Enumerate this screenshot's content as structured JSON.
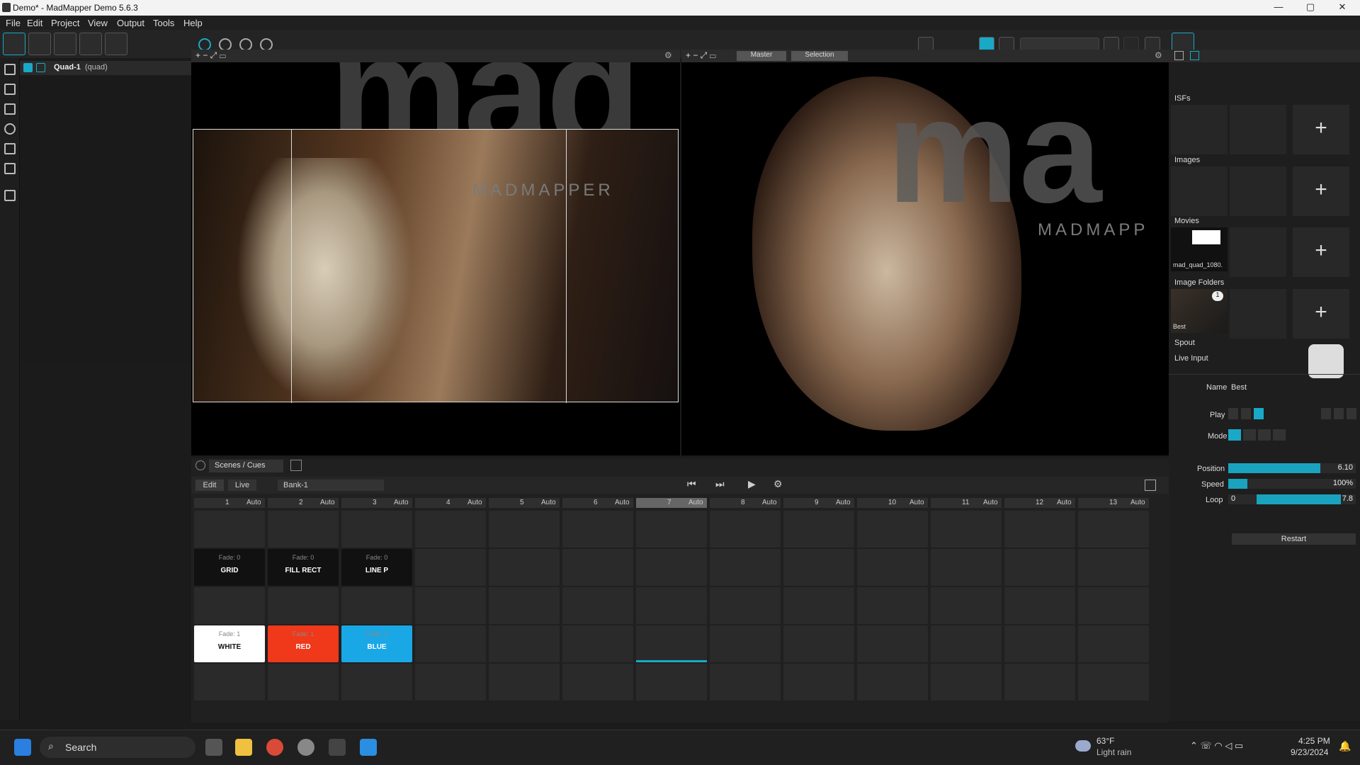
{
  "window": {
    "title": "Demo* - MadMapper Demo 5.6.3",
    "minimize": "—",
    "maximize": "▢",
    "close": "✕"
  },
  "menu": [
    "File",
    "Edit",
    "Project",
    "View",
    "Output",
    "Tools",
    "Help"
  ],
  "toolbar": {
    "icons": [
      "surfaces-icon",
      "lamp-icon",
      "output-icon",
      "cubes-icon",
      "gear-icon"
    ]
  },
  "layer": {
    "name": "Quad-1",
    "type": "(quad)"
  },
  "views": {
    "input_watermark": "MADMAPPER",
    "output_watermark": "MADMAPP",
    "output_tabs": [
      "Master",
      "Selection"
    ],
    "big_letters_left": "mad",
    "big_letters_right": "ma"
  },
  "library": {
    "sections": [
      "ISFs",
      "Images",
      "Movies",
      "Image Folders",
      "Spout",
      "Live Input"
    ],
    "movie_name": "mad_quad_1080.",
    "folder_name": "Best",
    "folder_badge": "1"
  },
  "properties": {
    "name_label": "Name",
    "name_value": "Best",
    "play_label": "Play",
    "mode_label": "Mode",
    "position_label": "Position",
    "position_value": "6.10",
    "position_fraction": 0.72,
    "speed_label": "Speed",
    "speed_value": "100%",
    "speed_fraction": 0.15,
    "loop_label": "Loop",
    "loop_start": "0",
    "loop_end": "7.8",
    "loop_fraction": 0.85,
    "restart": "Restart"
  },
  "scenes": {
    "panel_title": "Scenes / Cues",
    "edit": "Edit",
    "live": "Live",
    "bank": "Bank-1",
    "columns": [
      {
        "num": "1",
        "mode": "Auto"
      },
      {
        "num": "2",
        "mode": "Auto"
      },
      {
        "num": "3",
        "mode": "Auto"
      },
      {
        "num": "4",
        "mode": "Auto"
      },
      {
        "num": "5",
        "mode": "Auto"
      },
      {
        "num": "6",
        "mode": "Auto"
      },
      {
        "num": "7",
        "mode": "Auto"
      },
      {
        "num": "8",
        "mode": "Auto"
      },
      {
        "num": "9",
        "mode": "Auto"
      },
      {
        "num": "10",
        "mode": "Auto"
      },
      {
        "num": "11",
        "mode": "Auto"
      },
      {
        "num": "12",
        "mode": "Auto"
      },
      {
        "num": "13",
        "mode": "Auto"
      }
    ],
    "cues_row2": [
      {
        "fade": "Fade: 0",
        "label": "GRID"
      },
      {
        "fade": "Fade: 0",
        "label": "FILL RECT"
      },
      {
        "fade": "Fade: 0",
        "label": "LINE P"
      }
    ],
    "cues_row4": [
      {
        "fade": "Fade: 1",
        "label": "WHITE",
        "color": "#ffffff"
      },
      {
        "fade": "Fade: 1",
        "label": "RED",
        "color": "#f0381a"
      },
      {
        "fade": "Fade: 1",
        "label": "BLUE",
        "color": "#1aa7e6"
      }
    ]
  },
  "taskbar": {
    "search": "Search",
    "temp": "63°F",
    "weather": "Light rain",
    "time": "4:25 PM",
    "date": "9/23/2024"
  },
  "colors": {
    "accent": "#19a9c7"
  }
}
